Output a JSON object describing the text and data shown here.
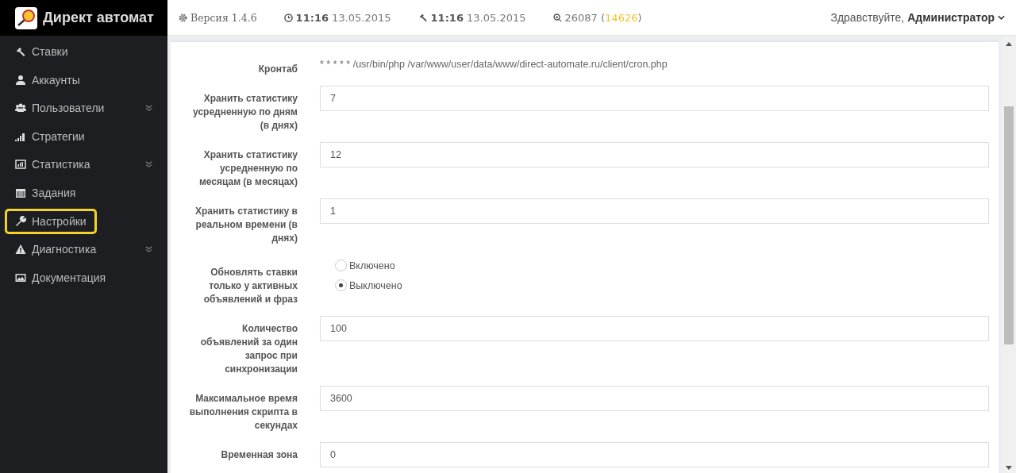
{
  "brand": {
    "title": "Директ автомат"
  },
  "topbar": {
    "version": "Версия 1.4.6",
    "times": [
      {
        "kind": "clock",
        "time": "11:16",
        "date": "13.05.2015"
      },
      {
        "kind": "gavel",
        "time": "11:16",
        "date": "13.05.2015"
      }
    ],
    "counter": {
      "total": "26087",
      "open": "(",
      "active": "14626",
      "close": ")"
    },
    "greeting": "Здравствуйте,",
    "user": "Администратор"
  },
  "sidebar": {
    "items": [
      {
        "kind": "gavel",
        "label": "Ставки",
        "expandable": false,
        "selected": false
      },
      {
        "kind": "user",
        "label": "Аккаунты",
        "expandable": false,
        "selected": false
      },
      {
        "kind": "users",
        "label": "Пользователи",
        "expandable": true,
        "selected": false
      },
      {
        "kind": "signal",
        "label": "Стратегии",
        "expandable": false,
        "selected": false
      },
      {
        "kind": "chart",
        "label": "Статистика",
        "expandable": true,
        "selected": false
      },
      {
        "kind": "calendar",
        "label": "Задания",
        "expandable": false,
        "selected": false
      },
      {
        "kind": "wrench",
        "label": "Настройки",
        "expandable": false,
        "selected": true
      },
      {
        "kind": "warning",
        "label": "Диагностика",
        "expandable": true,
        "selected": false
      },
      {
        "kind": "image",
        "label": "Документация",
        "expandable": false,
        "selected": false
      }
    ]
  },
  "form": {
    "rows": [
      {
        "kind": "text",
        "label": "Кронтаб",
        "value": "* * * * * /usr/bin/php /var/www/user/data/www/direct-automate.ru/client/cron.php"
      },
      {
        "kind": "input",
        "label": "Хранить статистику усредненную по дням (в днях)",
        "value": "7"
      },
      {
        "kind": "input",
        "label": "Хранить статистику усредненную по месяцам (в месяцах)",
        "value": "12"
      },
      {
        "kind": "input",
        "label": "Хранить статистику в реальном времени (в днях)",
        "value": "1"
      },
      {
        "kind": "radio",
        "label": "Обновлять ставки только у активных объявлений и фраз",
        "options": [
          {
            "label": "Включено",
            "selected": false
          },
          {
            "label": "Выключено",
            "selected": true
          }
        ]
      },
      {
        "kind": "input",
        "label": "Количество объявлений за один запрос при синхронизации",
        "value": "100"
      },
      {
        "kind": "input",
        "label": "Максимальное время выполнения скрипта в секундах",
        "value": "3600"
      },
      {
        "kind": "input",
        "label": "Временная зона",
        "value": "0"
      }
    ]
  }
}
